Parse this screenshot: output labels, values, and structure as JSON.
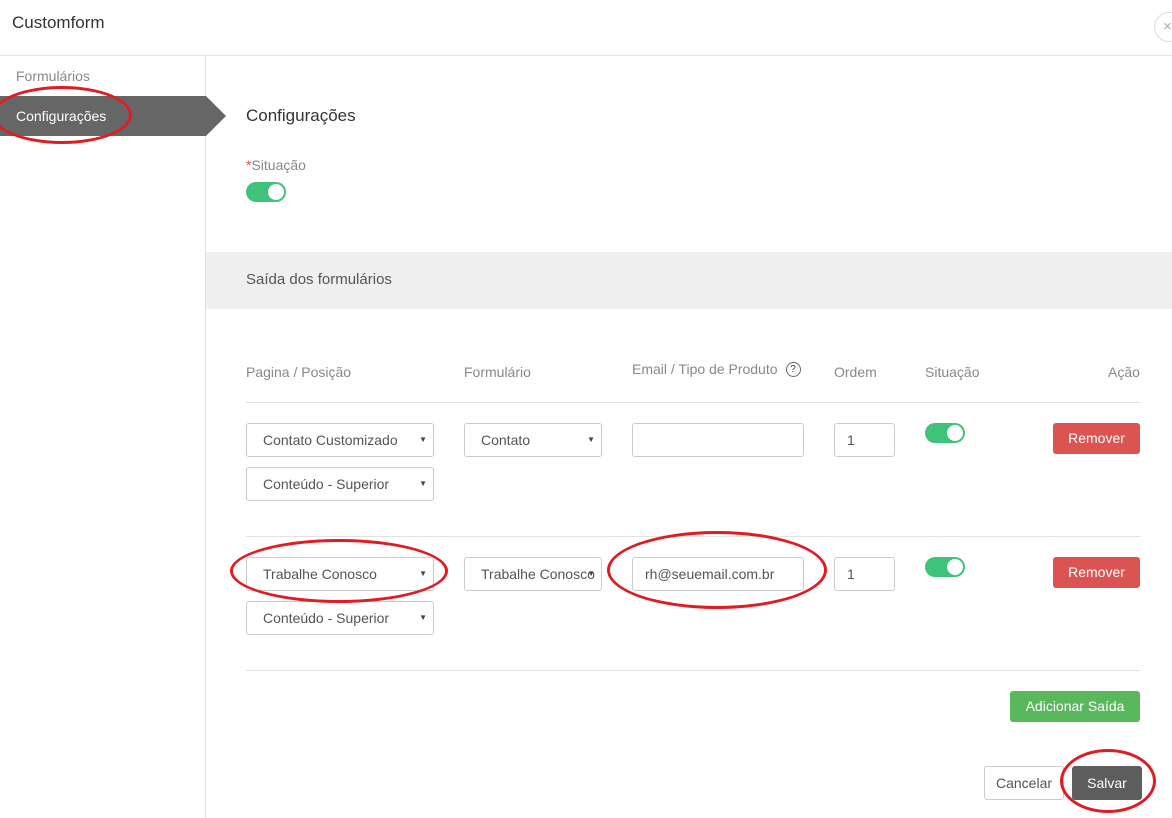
{
  "window": {
    "title": "Customform",
    "close_symbol": "×"
  },
  "sidebar": {
    "items": [
      {
        "label": "Formulários",
        "active": false
      },
      {
        "label": "Configurações",
        "active": true
      }
    ]
  },
  "main": {
    "title": "Configurações",
    "situacao": {
      "required_mark": "*",
      "label": "Situação",
      "enabled": true
    },
    "outputs_section": {
      "title": "Saída dos formulários",
      "columns": {
        "pagina": "Pagina / Posição",
        "formulario": "Formulário",
        "email": "Email / Tipo de Produto",
        "help_symbol": "?",
        "ordem": "Ordem",
        "situacao": "Situação",
        "acao": "Ação"
      },
      "rows": [
        {
          "page": "Contato Customizado",
          "position": "Conteúdo - Superior",
          "form": "Contato",
          "email": "",
          "order": "1",
          "enabled": true,
          "remove_label": "Remover"
        },
        {
          "page": "Trabalhe Conosco",
          "position": "Conteúdo - Superior",
          "form": "Trabalhe Conosco",
          "email": "rh@seuemail.com.br",
          "order": "1",
          "enabled": true,
          "remove_label": "Remover"
        }
      ],
      "add_label": "Adicionar Saída"
    },
    "footer": {
      "cancel_label": "Cancelar",
      "save_label": "Salvar"
    }
  },
  "colors": {
    "toggle_on": "#3fc37a",
    "remove_button": "#db5451",
    "add_button": "#59b85c",
    "save_button": "#5d5d5d",
    "sidebar_active": "#666666",
    "annotation_circle": "#e01c23"
  },
  "icons": {
    "close": "close-icon",
    "help": "help-circle-icon",
    "select_arrow": "caret-down-icon"
  }
}
